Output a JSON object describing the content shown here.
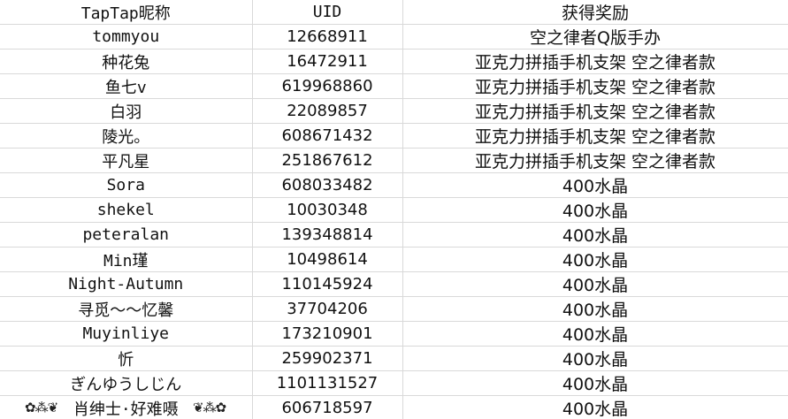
{
  "headers": [
    "TapTap昵称",
    "UID",
    "获得奖励"
  ],
  "rows": [
    {
      "name": "tommyou",
      "uid": "12668911",
      "reward": "空之律者Q版手办"
    },
    {
      "name": "种花兔",
      "uid": "16472911",
      "reward": "亚克力拼插手机支架 空之律者款"
    },
    {
      "name": "鱼七v",
      "uid": "619968860",
      "reward": "亚克力拼插手机支架 空之律者款"
    },
    {
      "name": "白羽",
      "uid": "22089857",
      "reward": "亚克力拼插手机支架 空之律者款"
    },
    {
      "name": "陵光。",
      "uid": "608671432",
      "reward": "亚克力拼插手机支架 空之律者款"
    },
    {
      "name": "平凡星",
      "uid": "251867612",
      "reward": "亚克力拼插手机支架 空之律者款"
    },
    {
      "name": "Sora",
      "uid": "608033482",
      "reward": "400水晶"
    },
    {
      "name": "shekel",
      "uid": "10030348",
      "reward": "400水晶"
    },
    {
      "name": "peteralan",
      "uid": "139348814",
      "reward": "400水晶"
    },
    {
      "name": "Min瑾",
      "uid": "10498614",
      "reward": "400水晶"
    },
    {
      "name": "Night-Autumn",
      "uid": "110145924",
      "reward": "400水晶"
    },
    {
      "name": "寻觅～～忆馨",
      "uid": "37704206",
      "reward": "400水晶"
    },
    {
      "name": "Muyinliye",
      "uid": "173210901",
      "reward": "400水晶"
    },
    {
      "name": "忻",
      "uid": "259902371",
      "reward": "400水晶"
    },
    {
      "name": "ぎんゆうしじん",
      "uid": "1101131527",
      "reward": "400水晶"
    },
    {
      "name": "肖绅士·好难嗫",
      "uid": "606718597",
      "reward": "400水晶"
    }
  ],
  "decor": {
    "left_flourish": "✿⁂❦",
    "right_flourish": "❦⁂✿"
  }
}
